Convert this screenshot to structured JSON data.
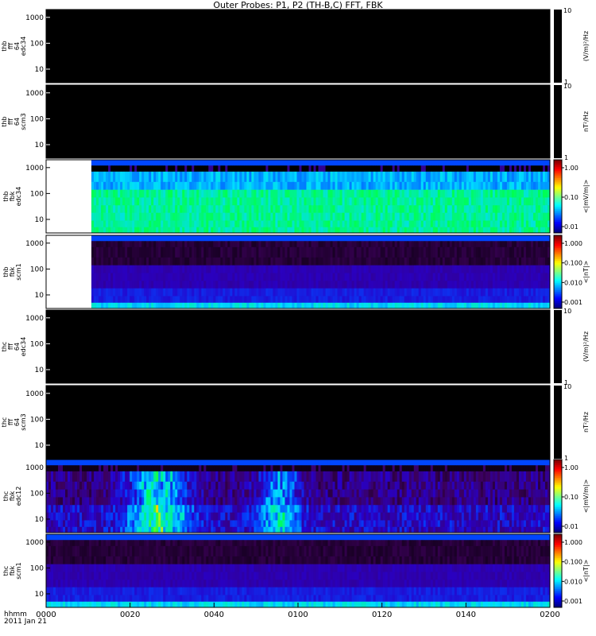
{
  "title": "Outer Probes: P1, P2 (TH-B,C) FFT, FBK",
  "time_axis": {
    "label_line1": "hhmm",
    "label_line2": "2011 Jan 21",
    "ticks": [
      "0000",
      "0020",
      "0040",
      "0100",
      "0120",
      "0140",
      "0200"
    ]
  },
  "chart_data": [
    {
      "type": "heatmap",
      "probe": "thb",
      "ylabel_lines": [
        "thb",
        "fff",
        "64",
        "edc34"
      ],
      "yticks": [
        "1000",
        "100",
        "10"
      ],
      "colorbar": {
        "label": "(V/m)²/Hz",
        "top": "10",
        "bottom": "1"
      },
      "fill": "empty",
      "data_start_fraction": 0.0
    },
    {
      "type": "heatmap",
      "probe": "thb",
      "ylabel_lines": [
        "thb",
        "fff",
        "64",
        "scm3"
      ],
      "yticks": [
        "1000",
        "100",
        "10"
      ],
      "colorbar": {
        "label": "nT²/Hz",
        "top": "10",
        "bottom": "1"
      },
      "fill": "empty",
      "data_start_fraction": 0.0
    },
    {
      "type": "heatmap",
      "probe": "thb",
      "ylabel_lines": [
        "thb",
        "fbk",
        "edc34"
      ],
      "yticks": [
        "1000",
        "100",
        "10"
      ],
      "colorbar": {
        "label": "<|mV/m|>",
        "ticks": [
          "1.00",
          "0.10",
          "0.01"
        ]
      },
      "fill": "efield",
      "data_start_fraction": 0.09
    },
    {
      "type": "heatmap",
      "probe": "thb",
      "ylabel_lines": [
        "thb",
        "fbk",
        "scm1"
      ],
      "yticks": [
        "1000",
        "100",
        "10"
      ],
      "colorbar": {
        "label": "<|nT|>",
        "ticks": [
          "1.000",
          "0.100",
          "0.010",
          "0.001"
        ]
      },
      "fill": "bfield",
      "data_start_fraction": 0.09
    },
    {
      "type": "heatmap",
      "probe": "thc",
      "ylabel_lines": [
        "thc",
        "fff",
        "64",
        "edc34"
      ],
      "yticks": [
        "1000",
        "100",
        "10"
      ],
      "colorbar": {
        "label": "(V/m)²/Hz",
        "top": "10",
        "bottom": "1"
      },
      "fill": "empty",
      "data_start_fraction": 0.0
    },
    {
      "type": "heatmap",
      "probe": "thc",
      "ylabel_lines": [
        "thc",
        "fff",
        "64",
        "scm3"
      ],
      "yticks": [
        "1000",
        "100",
        "10"
      ],
      "colorbar": {
        "label": "nT²/Hz",
        "top": "10",
        "bottom": "1"
      },
      "fill": "empty",
      "data_start_fraction": 0.0
    },
    {
      "type": "heatmap",
      "probe": "thc",
      "ylabel_lines": [
        "thc",
        "fbk",
        "edc12"
      ],
      "yticks": [
        "1000",
        "100",
        "10"
      ],
      "colorbar": {
        "label": "<|mV/m|>",
        "ticks": [
          "1.00",
          "0.10",
          "0.01"
        ]
      },
      "fill": "efield_active",
      "data_start_fraction": 0.0
    },
    {
      "type": "heatmap",
      "probe": "thc",
      "ylabel_lines": [
        "thc",
        "fbk",
        "scm1"
      ],
      "yticks": [
        "1000",
        "100",
        "10"
      ],
      "colorbar": {
        "label": "<|nT|>",
        "ticks": [
          "1.000",
          "0.100",
          "0.010",
          "0.001"
        ]
      },
      "fill": "bfield",
      "data_start_fraction": 0.0
    }
  ]
}
